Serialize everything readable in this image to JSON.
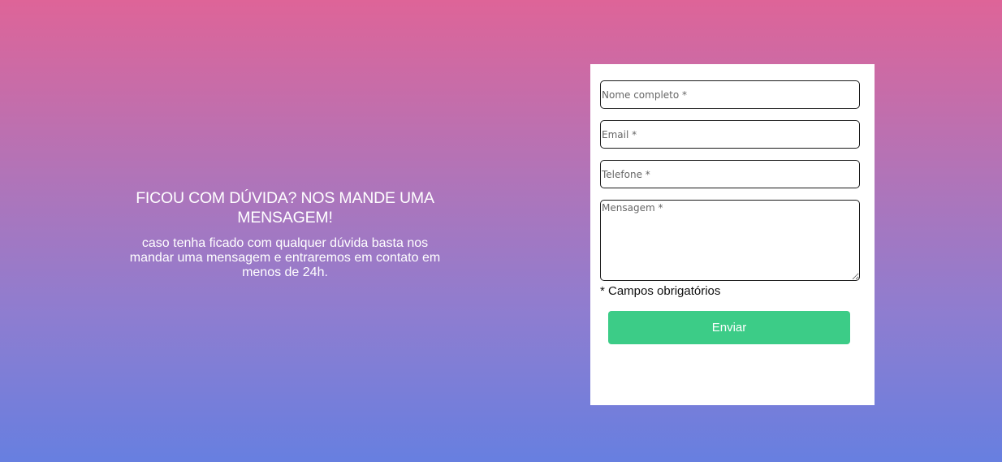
{
  "intro": {
    "title": "FICOU COM DÚVIDA? NOS MANDE UMA MENSAGEM!",
    "description": "caso tenha ficado com qualquer dúvida basta nos mandar uma mensagem e entraremos em contato em menos de 24h."
  },
  "form": {
    "name_placeholder": "Nome completo *",
    "email_placeholder": "Email *",
    "phone_placeholder": "Telefone *",
    "message_placeholder": "Mensagem *",
    "required_note": "* Campos obrigatórios",
    "submit_label": "Enviar"
  },
  "colors": {
    "gradient_top": "#de6498",
    "gradient_bottom": "#677fe0",
    "submit_button": "#3ccc87"
  }
}
